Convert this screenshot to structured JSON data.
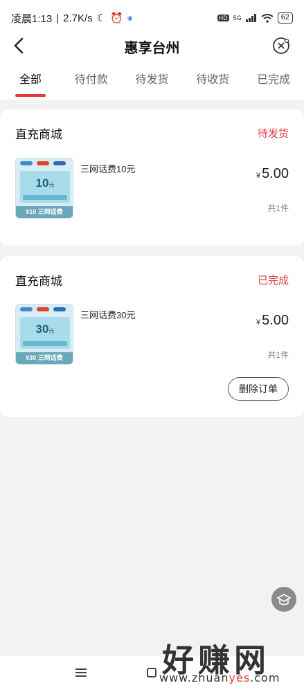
{
  "status_bar": {
    "time": "凌晨1:13",
    "speed": "2.7K/s",
    "network": "5G",
    "battery": "62"
  },
  "nav": {
    "title": "惠享台州"
  },
  "tabs": [
    {
      "label": "全部",
      "active": true
    },
    {
      "label": "待付款",
      "active": false
    },
    {
      "label": "待发货",
      "active": false
    },
    {
      "label": "待收货",
      "active": false
    },
    {
      "label": "已完成",
      "active": false
    }
  ],
  "orders": [
    {
      "shop": "直充商城",
      "status": "待发货",
      "product": "三网话费10元",
      "currency": "¥",
      "price": "5.00",
      "quantity": "共1件",
      "thumb_amount": "10",
      "thumb_unit": "元",
      "thumb_label": "¥10 三网话费"
    },
    {
      "shop": "直充商城",
      "status": "已完成",
      "product": "三网话费30元",
      "currency": "¥",
      "price": "5.00",
      "quantity": "共1件",
      "thumb_amount": "30",
      "thumb_unit": "元",
      "thumb_label": "¥30 三网话费",
      "action": "删除订单"
    }
  ],
  "watermark": {
    "big": "好赚网",
    "small_pre": "www.zhuan",
    "small_hl": "yes",
    "small_post": ".com"
  },
  "colors": {
    "accent": "#e4393c"
  }
}
